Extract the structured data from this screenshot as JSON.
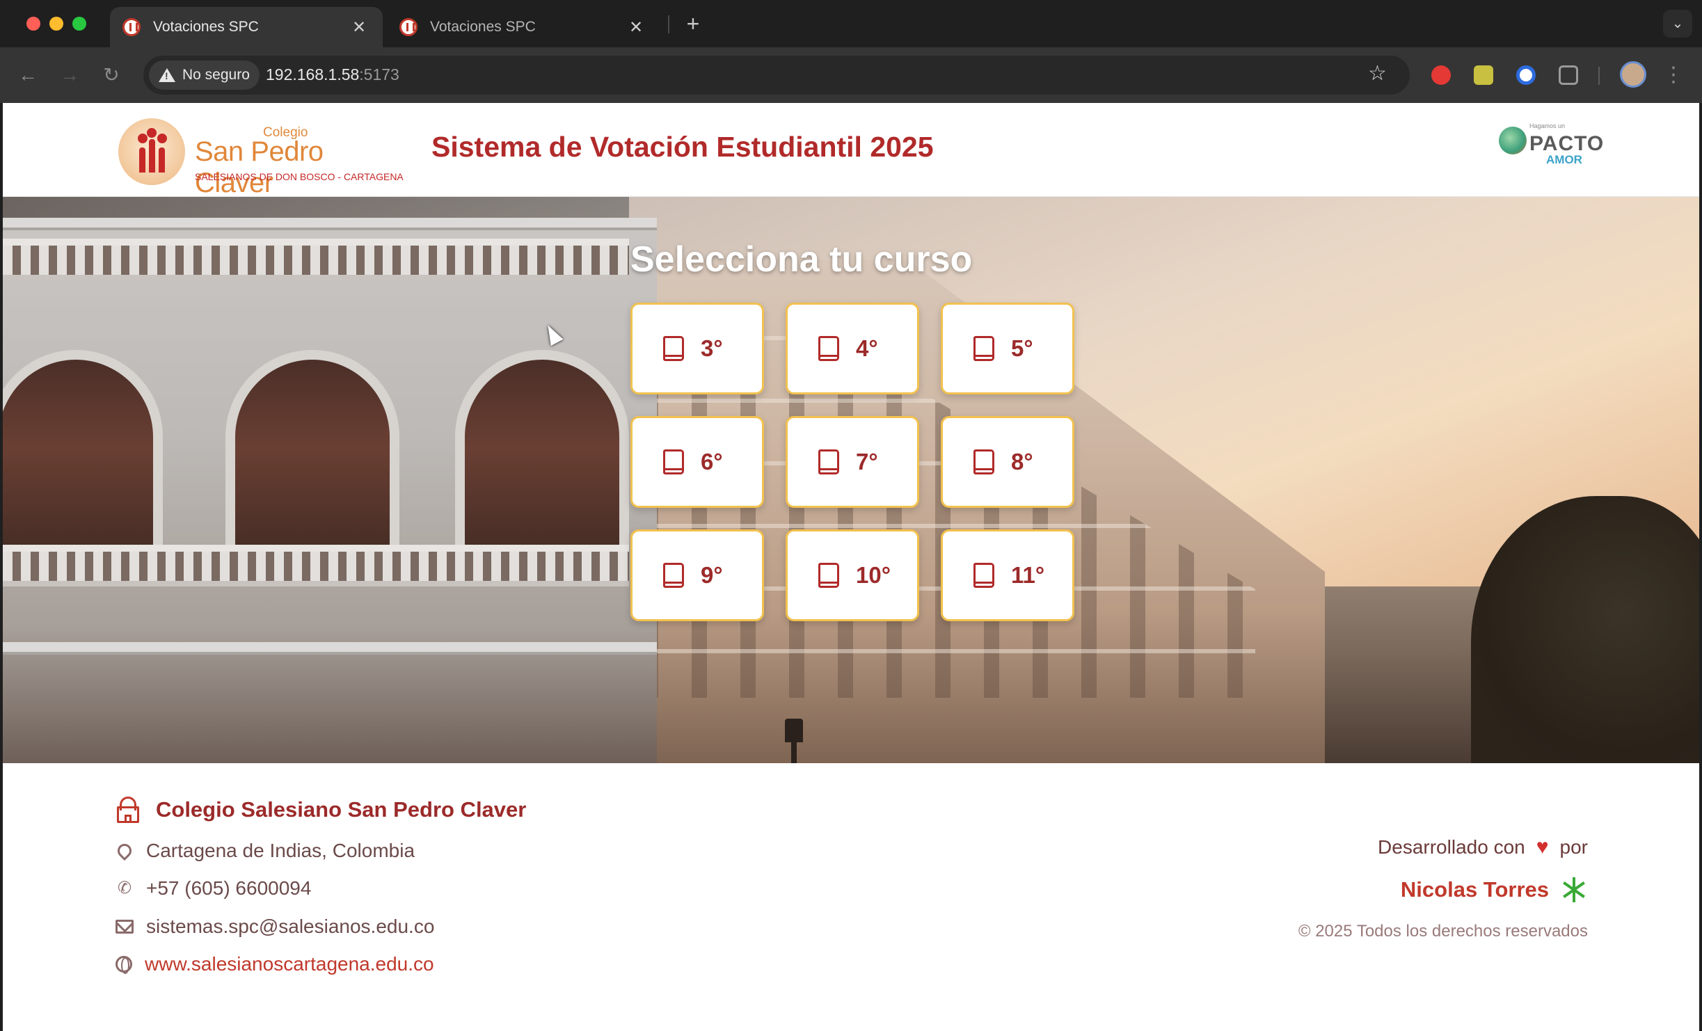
{
  "browser": {
    "tabs": [
      {
        "title": "Votaciones SPC",
        "active": true
      },
      {
        "title": "Votaciones SPC",
        "active": false
      }
    ],
    "close_glyph": "✕",
    "new_tab_glyph": "+",
    "tab_menu_glyph": "⌄",
    "security_label": "No seguro",
    "url_host": "192.168.1.58",
    "url_port": ":5173",
    "nav": {
      "back": "←",
      "forward": "→",
      "reload": "↻",
      "star": "☆",
      "menu": "⋮"
    }
  },
  "header": {
    "logo": {
      "small": "Colegio",
      "name": "San Pedro Claver",
      "sub": "SALESIANOS DE DON BOSCO - CARTAGENA"
    },
    "title": "Sistema de Votación Estudiantil 2025",
    "partner_logo": {
      "small": "Hagamos un",
      "word1": "PACTO",
      "word2": "AMOR"
    }
  },
  "hero": {
    "heading": "Selecciona tu curso",
    "courses": [
      {
        "label": "3°"
      },
      {
        "label": "4°"
      },
      {
        "label": "5°"
      },
      {
        "label": "6°"
      },
      {
        "label": "7°"
      },
      {
        "label": "8°"
      },
      {
        "label": "9°"
      },
      {
        "label": "10°"
      },
      {
        "label": "11°"
      }
    ]
  },
  "footer": {
    "school_name": "Colegio Salesiano San Pedro Claver",
    "location": "Cartagena de Indias, Colombia",
    "phone": "+57 (605) 6600094",
    "email": "sistemas.spc@salesianos.edu.co",
    "website": "www.salesianoscartagena.edu.co",
    "dev_prefix": "Desarrollado con",
    "dev_heart": "♥",
    "dev_suffix": "por",
    "dev_name": "Nicolas Torres",
    "copyright": "© 2025 Todos los derechos reservados"
  },
  "colors": {
    "brand_red": "#b12a2a",
    "card_border": "#f2c14e",
    "link_red": "#c0392b"
  },
  "icons": {
    "course": "book-icon",
    "school": "school-icon",
    "location": "map-pin-icon",
    "phone": "phone-icon",
    "email": "mail-icon",
    "website": "globe-icon",
    "love": "heart-icon",
    "sena": "sena-logo-icon"
  }
}
